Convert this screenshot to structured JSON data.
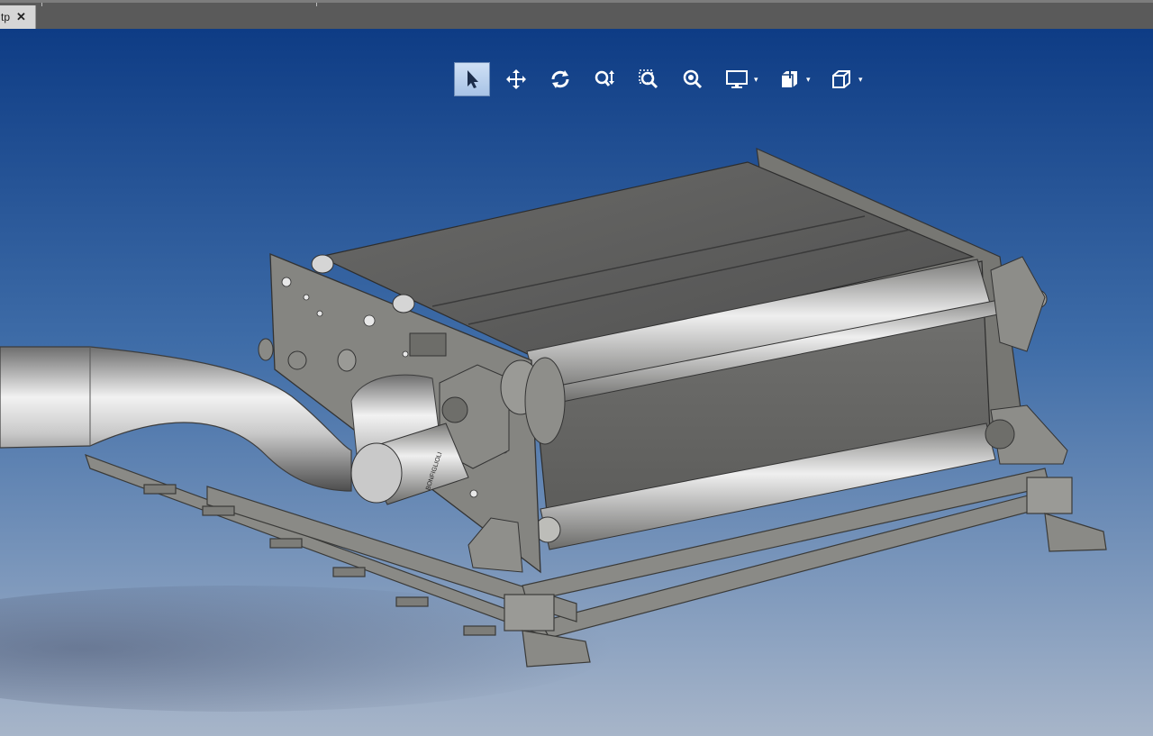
{
  "tab": {
    "label": "tp",
    "close_glyph": "✕"
  },
  "toolbar": {
    "buttons": [
      {
        "name": "select-arrow-icon",
        "active": true
      },
      {
        "name": "pan-move-icon"
      },
      {
        "name": "rotate-icon"
      },
      {
        "name": "zoom-updown-icon"
      },
      {
        "name": "zoom-window-icon"
      },
      {
        "name": "zoom-fit-icon"
      },
      {
        "name": "display-mode-icon",
        "dropdown": true
      },
      {
        "name": "section-view-icon",
        "dropdown": true
      },
      {
        "name": "view-orientation-cube-icon",
        "dropdown": true
      }
    ],
    "dropdown_glyph": "▾"
  },
  "model": {
    "motor_brand_label": "BONFIGLIOLI"
  },
  "colors": {
    "viewport_top": "#0f3e86",
    "viewport_bottom": "#9aabc2",
    "tabbar": "#5a5a5a",
    "metal": "#8c8c8a",
    "belt": "#5a5a5a"
  }
}
